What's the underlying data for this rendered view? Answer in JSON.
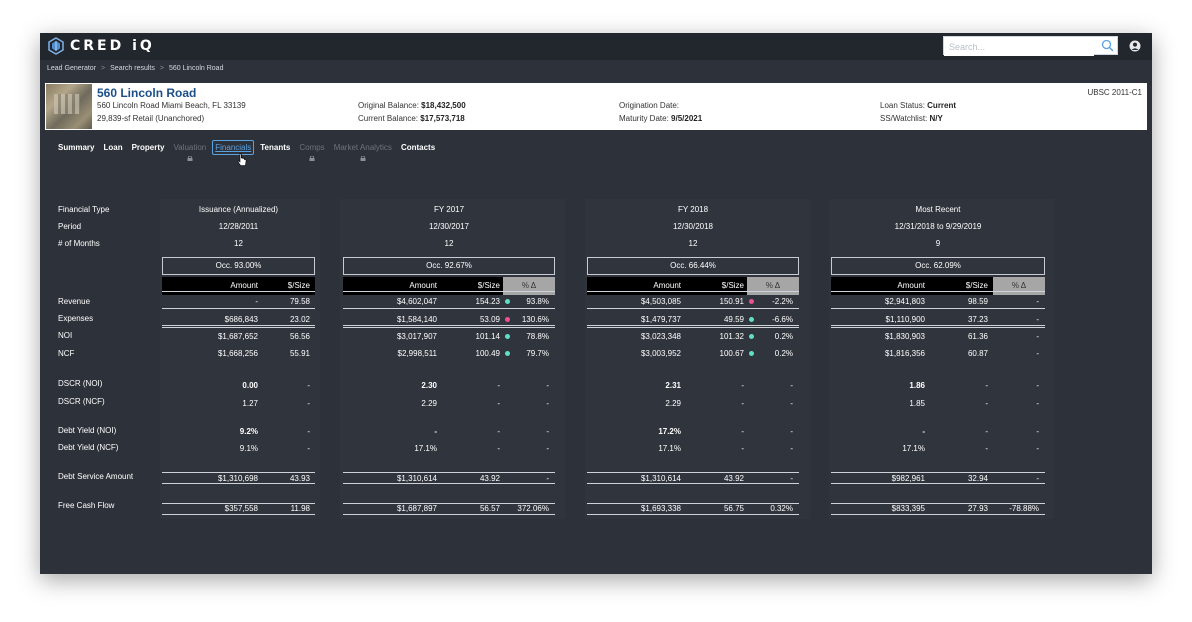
{
  "app": {
    "title": "CRED iQ",
    "search_placeholder": "Search..."
  },
  "breadcrumb": [
    "Lead Generator",
    "Search results",
    "560 Lincoln Road"
  ],
  "property": {
    "title": "560 Lincoln Road",
    "address": "560 Lincoln Road Miami Beach, FL 33139",
    "size": "29,839-sf Retail (Unanchored)",
    "original_balance_label": "Original Balance:",
    "original_balance": "$18,432,500",
    "current_balance_label": "Current Balance:",
    "current_balance": "$17,573,718",
    "origination_label": "Origination Date:",
    "origination_value": "",
    "maturity_label": "Maturity Date:",
    "maturity_value": "9/5/2021",
    "loan_status_label": "Loan Status:",
    "loan_status": "Current",
    "watchlist_label": "SS/Watchlist:",
    "watchlist": "N/Y",
    "deal": "UBSC 2011-C1"
  },
  "tabs": [
    {
      "label": "Summary",
      "state": "enabled"
    },
    {
      "label": "Loan",
      "state": "enabled"
    },
    {
      "label": "Property",
      "state": "enabled"
    },
    {
      "label": "Valuation",
      "state": "locked"
    },
    {
      "label": "Financials",
      "state": "active"
    },
    {
      "label": "Tenants",
      "state": "enabled"
    },
    {
      "label": "Comps",
      "state": "locked"
    },
    {
      "label": "Market Analytics",
      "state": "locked"
    },
    {
      "label": "Contacts",
      "state": "enabled"
    }
  ],
  "row_labels": {
    "financial_type": "Financial Type",
    "period": "Period",
    "months": "# of Months",
    "revenue": "Revenue",
    "expenses": "Expenses",
    "noi": "NOI",
    "ncf": "NCF",
    "dscr_noi": "DSCR (NOI)",
    "dscr_ncf": "DSCR (NCF)",
    "dy_noi": "Debt Yield (NOI)",
    "dy_ncf": "Debt Yield (NCF)",
    "debt_service": "Debt Service Amount",
    "free_cash_flow": "Free Cash Flow"
  },
  "col_headers": {
    "amount": "Amount",
    "size": "$/Size",
    "pct": "% Δ"
  },
  "colors": {
    "dot_green": "#5fe0c4",
    "dot_pink": "#f0508f",
    "accent": "#5ba2e0"
  },
  "periods": [
    {
      "type": "Issuance (Annualized)",
      "period": "12/28/2011",
      "months": "12",
      "occ": "Occ. 93.00%",
      "revenue": {
        "amount": "-",
        "size": "79.58",
        "pct": ""
      },
      "expenses": {
        "amount": "$686,843",
        "size": "23.02",
        "pct": ""
      },
      "noi": {
        "amount": "$1,687,652",
        "size": "56.56",
        "pct": ""
      },
      "ncf": {
        "amount": "$1,668,256",
        "size": "55.91",
        "pct": ""
      },
      "dscr_noi": {
        "amount": "0.00",
        "size": "-",
        "pct": ""
      },
      "dscr_ncf": {
        "amount": "1.27",
        "size": "-",
        "pct": ""
      },
      "dy_noi": {
        "amount": "9.2%",
        "size": "-",
        "pct": ""
      },
      "dy_ncf": {
        "amount": "9.1%",
        "size": "-",
        "pct": ""
      },
      "debt_service": {
        "amount": "$1,310,698",
        "size": "43.93",
        "pct": ""
      },
      "free_cash_flow": {
        "amount": "$357,558",
        "size": "11.98",
        "pct": ""
      }
    },
    {
      "type": "FY 2017",
      "period": "12/30/2017",
      "months": "12",
      "occ": "Occ. 92.67%",
      "revenue": {
        "amount": "$4,602,047",
        "size": "154.23",
        "pct": "93.8%",
        "dot": "green"
      },
      "expenses": {
        "amount": "$1,584,140",
        "size": "53.09",
        "pct": "130.6%",
        "dot": "pink"
      },
      "noi": {
        "amount": "$3,017,907",
        "size": "101.14",
        "pct": "78.8%",
        "dot": "green"
      },
      "ncf": {
        "amount": "$2,998,511",
        "size": "100.49",
        "pct": "79.7%",
        "dot": "green"
      },
      "dscr_noi": {
        "amount": "2.30",
        "size": "-",
        "pct": "-"
      },
      "dscr_ncf": {
        "amount": "2.29",
        "size": "-",
        "pct": "-"
      },
      "dy_noi": {
        "amount": "-",
        "size": "-",
        "pct": "-"
      },
      "dy_ncf": {
        "amount": "17.1%",
        "size": "-",
        "pct": "-"
      },
      "debt_service": {
        "amount": "$1,310,614",
        "size": "43.92",
        "pct": "-"
      },
      "free_cash_flow": {
        "amount": "$1,687,897",
        "size": "56.57",
        "pct": "372.06%"
      }
    },
    {
      "type": "FY 2018",
      "period": "12/30/2018",
      "months": "12",
      "occ": "Occ. 66.44%",
      "revenue": {
        "amount": "$4,503,085",
        "size": "150.91",
        "pct": "-2.2%",
        "dot": "pink"
      },
      "expenses": {
        "amount": "$1,479,737",
        "size": "49.59",
        "pct": "-6.6%",
        "dot": "green"
      },
      "noi": {
        "amount": "$3,023,348",
        "size": "101.32",
        "pct": "0.2%",
        "dot": "green"
      },
      "ncf": {
        "amount": "$3,003,952",
        "size": "100.67",
        "pct": "0.2%",
        "dot": "green"
      },
      "dscr_noi": {
        "amount": "2.31",
        "size": "-",
        "pct": "-"
      },
      "dscr_ncf": {
        "amount": "2.29",
        "size": "-",
        "pct": "-"
      },
      "dy_noi": {
        "amount": "17.2%",
        "size": "-",
        "pct": "-"
      },
      "dy_ncf": {
        "amount": "17.1%",
        "size": "-",
        "pct": "-"
      },
      "debt_service": {
        "amount": "$1,310,614",
        "size": "43.92",
        "pct": "-"
      },
      "free_cash_flow": {
        "amount": "$1,693,338",
        "size": "56.75",
        "pct": "0.32%"
      }
    },
    {
      "type": "Most Recent",
      "period": "12/31/2018 to 9/29/2019",
      "months": "9",
      "occ": "Occ. 62.09%",
      "revenue": {
        "amount": "$2,941,803",
        "size": "98.59",
        "pct": "-"
      },
      "expenses": {
        "amount": "$1,110,900",
        "size": "37.23",
        "pct": "-"
      },
      "noi": {
        "amount": "$1,830,903",
        "size": "61.36",
        "pct": "-"
      },
      "ncf": {
        "amount": "$1,816,356",
        "size": "60.87",
        "pct": "-"
      },
      "dscr_noi": {
        "amount": "1.86",
        "size": "-",
        "pct": "-"
      },
      "dscr_ncf": {
        "amount": "1.85",
        "size": "-",
        "pct": "-"
      },
      "dy_noi": {
        "amount": "-",
        "size": "-",
        "pct": "-"
      },
      "dy_ncf": {
        "amount": "17.1%",
        "size": "-",
        "pct": "-"
      },
      "debt_service": {
        "amount": "$982,961",
        "size": "32.94",
        "pct": "-"
      },
      "free_cash_flow": {
        "amount": "$833,395",
        "size": "27.93",
        "pct": "-78.88%"
      }
    }
  ]
}
